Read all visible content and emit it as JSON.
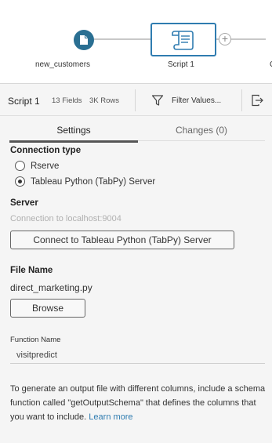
{
  "flow": {
    "input_node_label": "new_customers",
    "script_node_label": "Script 1",
    "next_node_partial_label": "C"
  },
  "toolbar": {
    "step_name": "Script 1",
    "fields": "13 Fields",
    "rows": "3K Rows",
    "filter_label": "Filter Values..."
  },
  "tabs": {
    "settings": "Settings",
    "changes": "Changes (0)"
  },
  "settings": {
    "connection_type_title": "Connection type",
    "options": [
      {
        "label": "Rserve",
        "selected": false
      },
      {
        "label": "Tableau Python (TabPy) Server",
        "selected": true
      }
    ],
    "server_title": "Server",
    "server_placeholder": "Connection to localhost:9004",
    "connect_button": "Connect to Tableau Python (TabPy) Server",
    "file_name_title": "File Name",
    "file_name_value": "direct_marketing.py",
    "browse_button": "Browse",
    "function_name_label": "Function Name",
    "function_name_value": "visitpredict",
    "help_text": "To generate an output file with different columns, include a schema function called \"getOutputSchema\" that defines the columns that you want to include. ",
    "learn_more": "Learn more"
  },
  "colors": {
    "accent": "#2f7cb0",
    "input_node": "#2a6f92"
  }
}
